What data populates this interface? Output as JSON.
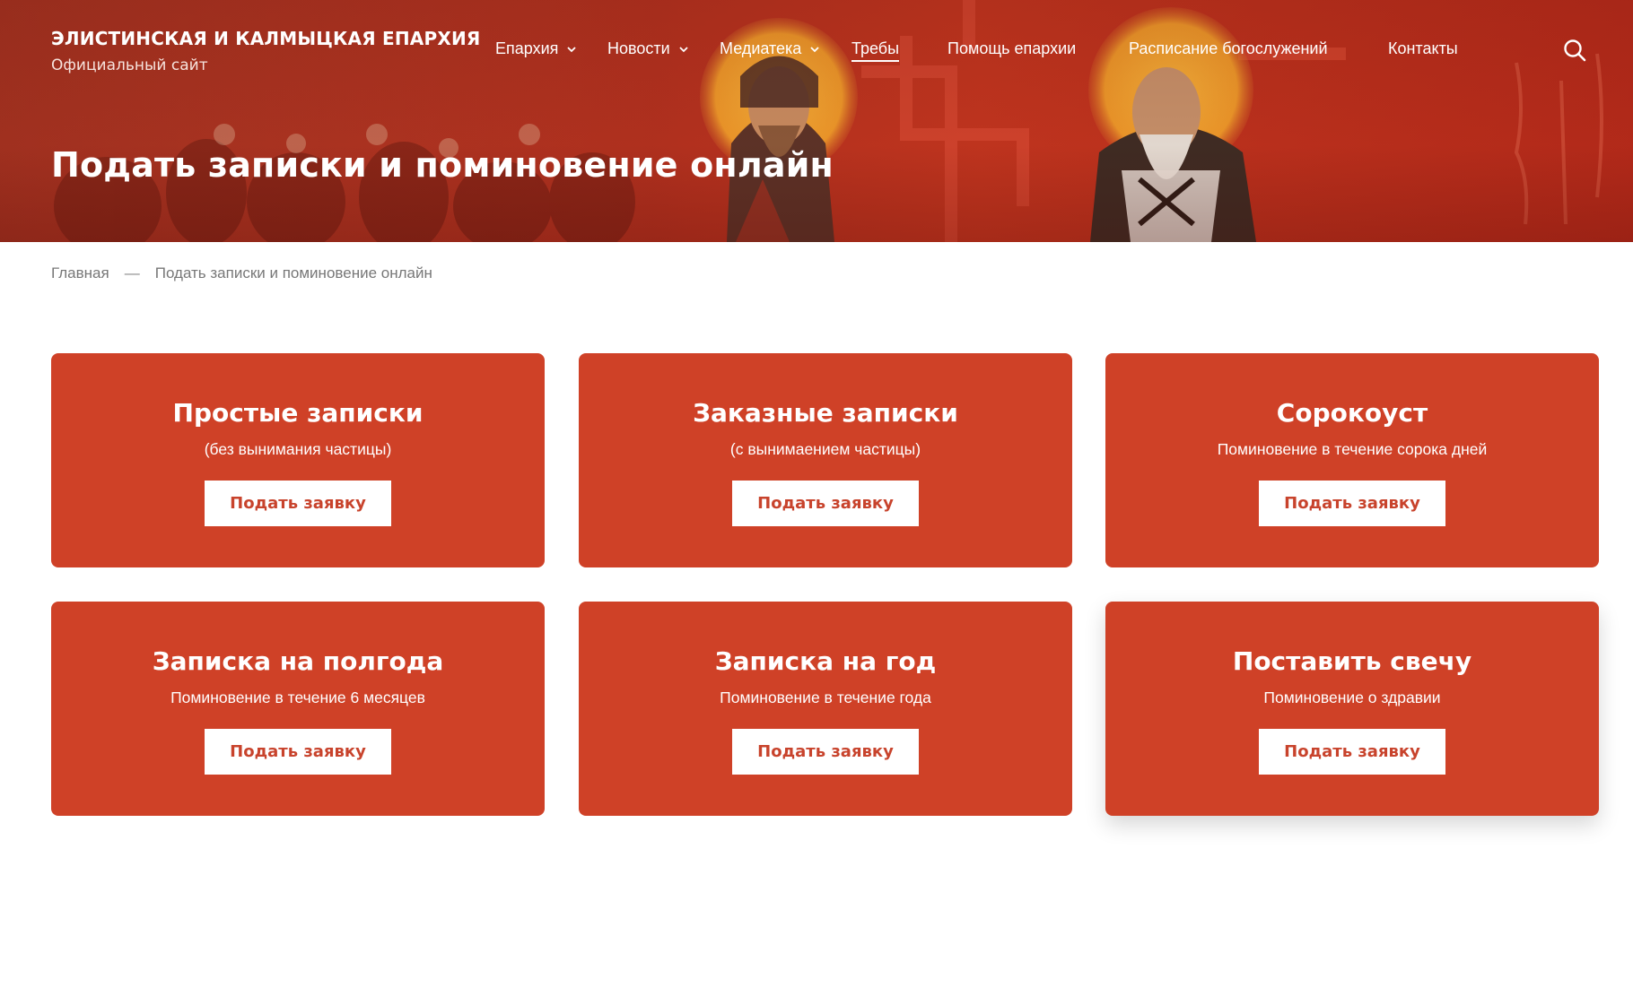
{
  "site": {
    "title": "ЭЛИСТИНСКАЯ И КАЛМЫЦКАЯ ЕПАРХИЯ",
    "subtitle": "Официальный сайт"
  },
  "nav": {
    "items": [
      {
        "label": "Епархия",
        "dropdown": true,
        "active": false
      },
      {
        "label": "Новости",
        "dropdown": true,
        "active": false
      },
      {
        "label": "Медиатека",
        "dropdown": true,
        "active": false
      },
      {
        "label": "Требы",
        "dropdown": false,
        "active": true
      },
      {
        "label": "Помощь епархии",
        "dropdown": false,
        "active": false
      },
      {
        "label": "Расписание богослужений",
        "dropdown": false,
        "active": false
      },
      {
        "label": "Контакты",
        "dropdown": false,
        "active": false
      }
    ],
    "search_icon": "search-icon"
  },
  "hero": {
    "title": "Подать записки и поминовение онлайн"
  },
  "breadcrumb": {
    "home": "Главная",
    "separator": "—",
    "current": "Подать записки и поминовение онлайн"
  },
  "cards": [
    {
      "title": "Простые записки",
      "subtitle": "(без вынимания частицы)",
      "button": "Подать заявку"
    },
    {
      "title": "Заказные записки",
      "subtitle": "(с вынимаением частицы)",
      "button": "Подать заявку"
    },
    {
      "title": "Сорокоуст",
      "subtitle": "Поминовение в течение сорока дней",
      "button": "Подать заявку"
    },
    {
      "title": "Записка на полгода",
      "subtitle": "Поминовение в течение 6 месяцев",
      "button": "Подать заявку"
    },
    {
      "title": "Записка на год",
      "subtitle": "Поминовение в течение года",
      "button": "Подать заявку"
    },
    {
      "title": "Поставить свечу",
      "subtitle": "Поминовение о здравии",
      "button": "Подать заявку"
    }
  ],
  "colors": {
    "accent": "#cf4127",
    "hero": "#b8301e",
    "button_text": "#c8432c"
  }
}
